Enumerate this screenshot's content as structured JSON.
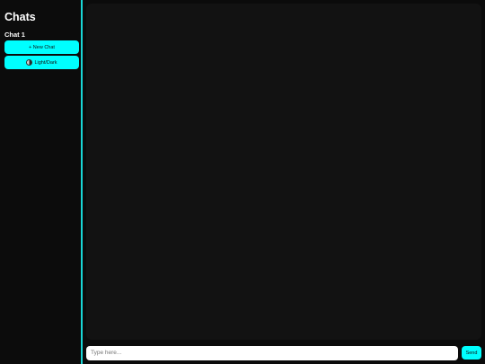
{
  "sidebar": {
    "title": "Chats",
    "chats": [
      {
        "label": "Chat 1"
      }
    ],
    "new_chat_label": "+ New Chat",
    "theme_toggle_icon": "half-moon-icon",
    "theme_toggle_label": "Light/Dark"
  },
  "composer": {
    "placeholder": "Type here...",
    "value": "",
    "send_label": "Send"
  },
  "colors": {
    "accent": "#00ffff",
    "sidebar_border": "#19d6d6",
    "background": "#0b0b0b",
    "panel": "#121212"
  }
}
